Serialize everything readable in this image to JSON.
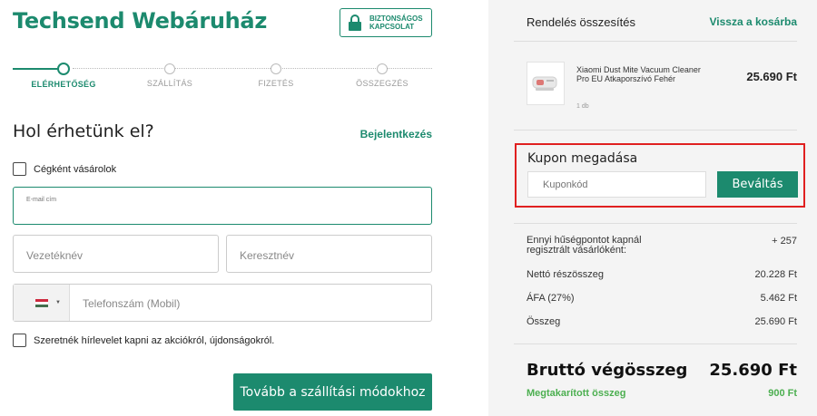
{
  "header": {
    "brand": "Techsend Webáruház",
    "secure_line1": "BIZTONSÁGOS",
    "secure_line2": "KAPCSOLAT"
  },
  "steps": [
    {
      "label": "ELÉRHETŐSÉG",
      "active": true
    },
    {
      "label": "SZÁLLÍTÁS",
      "active": false
    },
    {
      "label": "FIZETÉS",
      "active": false
    },
    {
      "label": "ÖSSZEGZÉS",
      "active": false
    }
  ],
  "form": {
    "heading": "Hol érhetünk el?",
    "login_link": "Bejelentkezés",
    "company_checkbox": "Cégként vásárolok",
    "email_placeholder": "E-mail cím",
    "last_name_placeholder": "Vezetéknév",
    "first_name_placeholder": "Keresztnév",
    "phone_placeholder": "Telefonszám (Mobil)",
    "newsletter_checkbox": "Szeretnék hírlevelet kapni az akciókról, újdonságokról.",
    "continue_button": "Tovább a szállítási módokhoz"
  },
  "summary": {
    "title": "Rendelés összesítés",
    "back_link": "Vissza a kosárba",
    "product": {
      "name": "Xiaomi Dust Mite Vacuum Cleaner Pro EU Atkaporszívó Fehér",
      "qty": "1 db",
      "price": "25.690 Ft"
    },
    "coupon": {
      "title": "Kupon megadása",
      "placeholder": "Kuponkód",
      "button": "Beváltás"
    },
    "loyalty_label": "Ennyi hűségpontot kapnál regisztrált vásárlóként:",
    "loyalty_value": "+ 257",
    "net_label": "Nettó részösszeg",
    "net_value": "20.228 Ft",
    "vat_label": "ÁFA (27%)",
    "vat_value": "5.462 Ft",
    "sum_label": "Összeg",
    "sum_value": "25.690 Ft",
    "gross_label": "Bruttó végösszeg",
    "gross_value": "25.690 Ft",
    "saved_label": "Megtakarított összeg",
    "saved_value": "900 Ft"
  },
  "colors": {
    "accent": "#1c8a6e",
    "highlight": "#e02020",
    "saved": "#4caf50"
  }
}
